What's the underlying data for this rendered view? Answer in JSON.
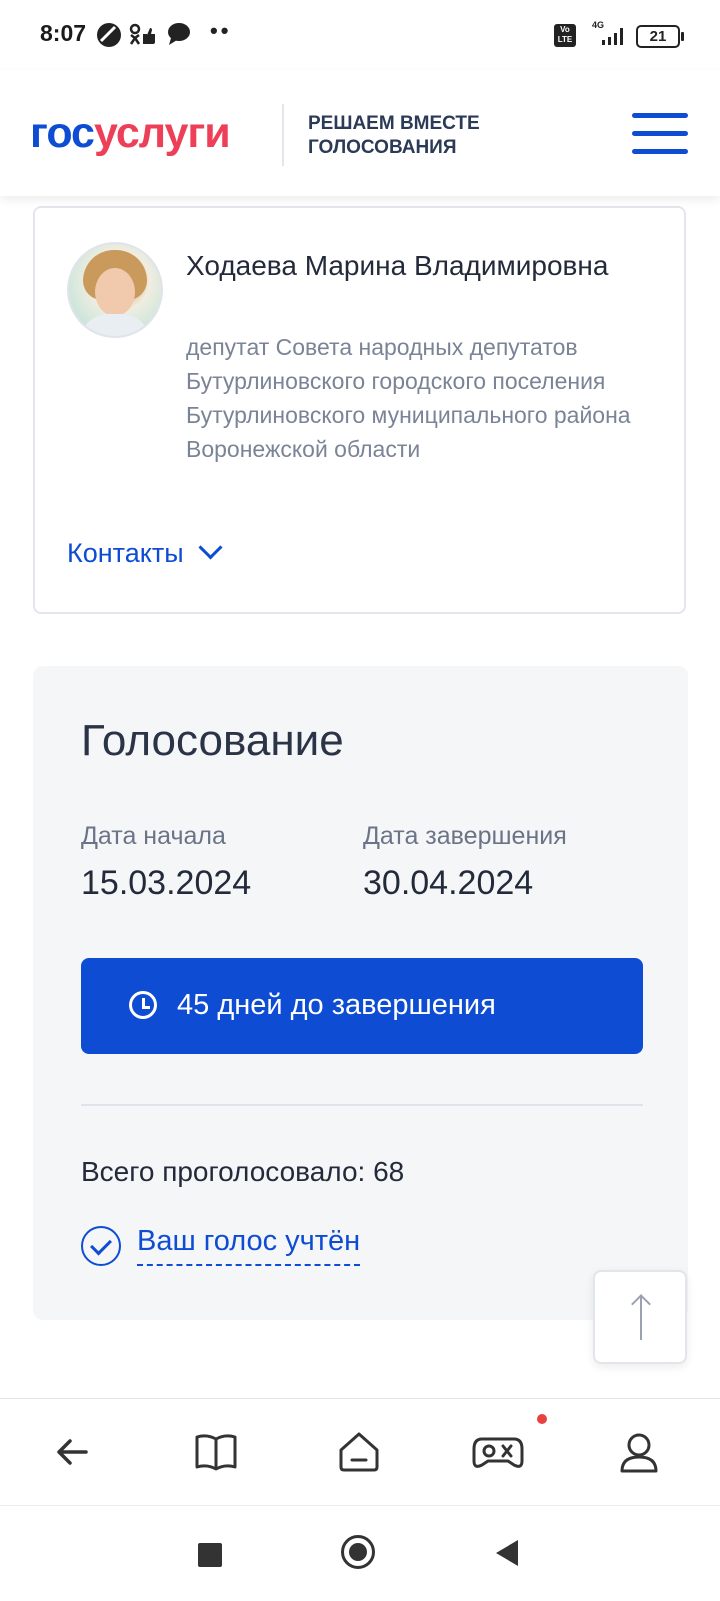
{
  "status_bar": {
    "time": "8:07",
    "battery": "21",
    "network": "4G",
    "volte": "Vo LTE"
  },
  "header": {
    "logo_part1": "гос",
    "logo_part2": "услуги",
    "tagline_line1": "РЕШАЕМ ВМЕСТЕ",
    "tagline_line2": "ГОЛОСОВАНИЯ"
  },
  "person": {
    "name": "Ходаева Марина Владимировна",
    "role": "депутат Совета народных депутатов Бутурлиновского городского поселения Бутурлиновского муниципального района Воронежской области",
    "contacts_label": "Контакты"
  },
  "voting": {
    "title": "Голосование",
    "start_label": "Дата начала",
    "start_date": "15.03.2024",
    "end_label": "Дата завершения",
    "end_date": "30.04.2024",
    "days_left": "45 дней до завершения",
    "total_votes": "Всего проголосовало: 68",
    "vote_status": "Ваш голос учтён"
  },
  "colors": {
    "accent": "#0d4cd3",
    "logo_red": "#ee3f58",
    "card_bg": "#f5f6f8"
  },
  "browser_nav": {
    "icons": [
      "back-arrow-icon",
      "book-icon",
      "home-icon",
      "gamepad-icon",
      "profile-icon"
    ]
  }
}
